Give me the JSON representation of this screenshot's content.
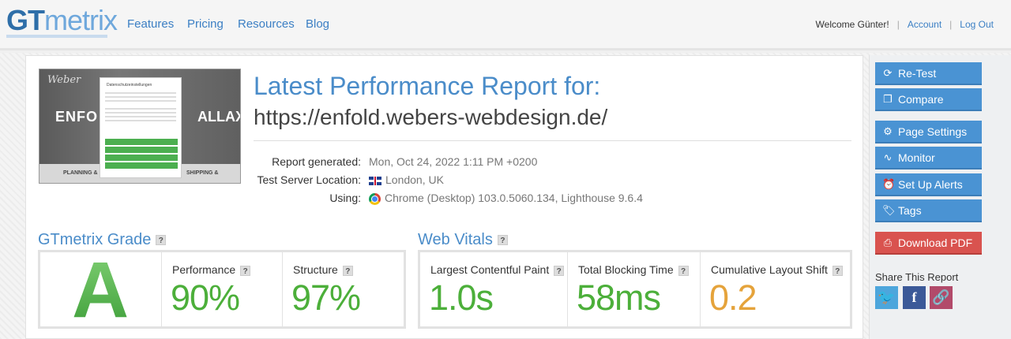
{
  "brand": {
    "gt": "GT",
    "metrix": "metrix"
  },
  "nav": {
    "features": "Features",
    "pricing": "Pricing",
    "resources": "Resources",
    "blog": "Blog"
  },
  "user": {
    "welcome": "Welcome Günter!",
    "account": "Account",
    "logout": "Log Out"
  },
  "report": {
    "title": "Latest Performance Report for:",
    "url": "https://enfold.webers-webdesign.de/",
    "generated_label": "Report generated:",
    "generated_value": "Mon, Oct 24, 2022 1:11 PM +0200",
    "location_label": "Test Server Location:",
    "location_value": "London, UK",
    "using_label": "Using:",
    "using_value": "Chrome (Desktop) 103.0.5060.134, Lighthouse 9.6.4"
  },
  "thumb": {
    "brand": "Weber",
    "left_word": "ENFO",
    "right_word": "ALLAX",
    "dialog_title": "Datenschutzeinstellungen",
    "bottom_left": "PLANNING &",
    "bottom_right": "SHIPPING &"
  },
  "grade": {
    "section_title": "GTmetrix Grade",
    "help": "?",
    "letter": "A",
    "performance_label": "Performance",
    "performance_value": "90%",
    "structure_label": "Structure",
    "structure_value": "97%"
  },
  "vitals": {
    "section_title": "Web Vitals",
    "help": "?",
    "lcp_label": "Largest Contentful Paint",
    "lcp_value": "1.0s",
    "tbt_label": "Total Blocking Time",
    "tbt_value": "58ms",
    "cls_label": "Cumulative Layout Shift",
    "cls_value": "0.2"
  },
  "colors": {
    "good": "#4caf3a",
    "warn": "#e5a33b",
    "accent": "#4a8cc9"
  },
  "sidebar": {
    "retest": "Re-Test",
    "compare": "Compare",
    "page_settings": "Page Settings",
    "monitor": "Monitor",
    "alerts": "Set Up Alerts",
    "tags": "Tags",
    "download_pdf": "Download PDF",
    "share_title": "Share This Report"
  }
}
